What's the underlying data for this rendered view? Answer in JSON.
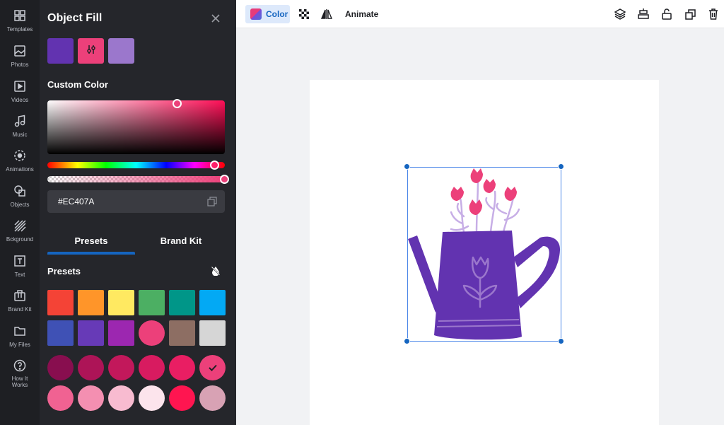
{
  "sidebar": {
    "items": [
      {
        "label": "Templates",
        "icon": "templates-icon"
      },
      {
        "label": "Photos",
        "icon": "photo-icon"
      },
      {
        "label": "Videos",
        "icon": "video-icon"
      },
      {
        "label": "Music",
        "icon": "music-icon"
      },
      {
        "label": "Animations",
        "icon": "animation-icon"
      },
      {
        "label": "Objects",
        "icon": "objects-icon"
      },
      {
        "label": "Bckground",
        "icon": "background-icon"
      },
      {
        "label": "Text",
        "icon": "text-icon"
      },
      {
        "label": "Brand Kit",
        "icon": "brand-kit-icon"
      },
      {
        "label": "My Files",
        "icon": "folder-icon"
      },
      {
        "label": "How It Works",
        "icon": "help-icon"
      }
    ]
  },
  "panel": {
    "title": "Object Fill",
    "close_icon": "close-icon",
    "recent_colors": [
      "#6233b0",
      "#ec407a",
      "#9b77cc"
    ],
    "custom_color_label": "Custom Color",
    "hex_value": "#EC407A",
    "tabs": [
      {
        "label": "Presets",
        "active": true
      },
      {
        "label": "Brand Kit",
        "active": false
      }
    ],
    "presets_label": "Presets",
    "presets": {
      "row1": [
        "#f44336",
        "#ff9529",
        "#ffe961",
        "#4caf63",
        "#009688",
        "#03a9f4"
      ],
      "row2": [
        "#3f51b5",
        "#673ab7",
        "#9c27b0",
        "#ec407a",
        "#8d6e63",
        "#d6d6d6"
      ],
      "row3": [
        "#880e4f",
        "#ad1457",
        "#c2185b",
        "#d81b60",
        "#e91e63",
        "#ec407a"
      ],
      "row4": [
        "#f06292",
        "#f48fb1",
        "#f8bbd0",
        "#fce4ec",
        "#ff1550",
        "#d8a2b4"
      ],
      "selected": "#ec407a"
    }
  },
  "toolbar": {
    "color_label": "Color",
    "animate_label": "Animate",
    "left_icons": [
      "transparency-icon",
      "flip-icon"
    ],
    "right_icons": [
      "layers-icon",
      "align-icon",
      "lock-icon",
      "duplicate-icon",
      "delete-icon"
    ]
  },
  "canvas": {
    "object": "watering-can",
    "colors": {
      "can": "#6233b0",
      "flowers": "#ec407a",
      "stems": "#c7aee6"
    }
  }
}
